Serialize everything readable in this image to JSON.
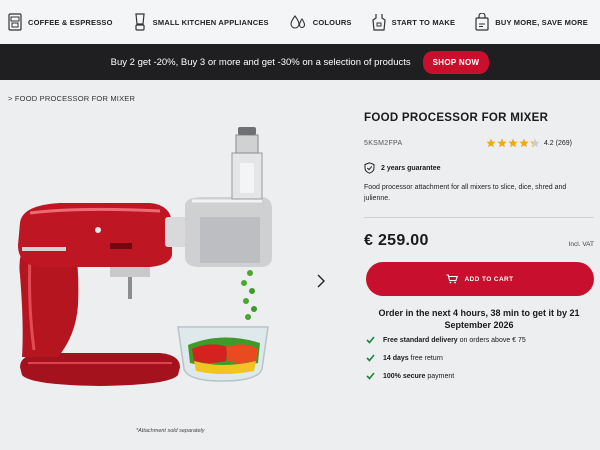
{
  "topnav": {
    "items": [
      {
        "label": "COFFEE & ESPRESSO",
        "icon": "coffee-machine-icon"
      },
      {
        "label": "SMALL KITCHEN APPLIANCES",
        "icon": "blender-icon"
      },
      {
        "label": "COLOURS",
        "icon": "colour-drops-icon"
      },
      {
        "label": "START TO MAKE",
        "icon": "apron-icon"
      },
      {
        "label": "BUY MORE, SAVE MORE",
        "icon": "shopping-bag-icon"
      }
    ]
  },
  "promo": {
    "text": "Buy 2 get -20%, Buy 3 or more and get -30% on a selection of products",
    "button_label": "SHOP NOW"
  },
  "breadcrumb": {
    "separator": ">",
    "current": "FOOD PROCESSOR FOR MIXER"
  },
  "product": {
    "title": "FOOD PROCESSOR FOR MIXER",
    "sku": "5KSM2FPA",
    "rating_text": "4.2 (269)",
    "rating_value": 4.2,
    "rating_max": 5,
    "guarantee": "2 years guarantee",
    "description": "Food processor attachment for all mixers to slice, dice, shred and julienne.",
    "price": "€ 259.00",
    "vat": "Incl. VAT",
    "cart_label": "ADD TO CART",
    "image_caption": "*Attachment sold separately"
  },
  "order_info": "Order in the next 4 hours, 38 min to get it by 21 September 2026",
  "benefits": [
    {
      "bold": "Free standard delivery",
      "rest": " on orders above € 75"
    },
    {
      "bold": "14 days",
      "rest": " free return"
    },
    {
      "bold": "100% secure",
      "rest": " payment"
    }
  ],
  "colors": {
    "accent": "#c8102e",
    "banner": "#1f1f22",
    "star": "#f0a81a",
    "check": "#1a8a3a"
  }
}
